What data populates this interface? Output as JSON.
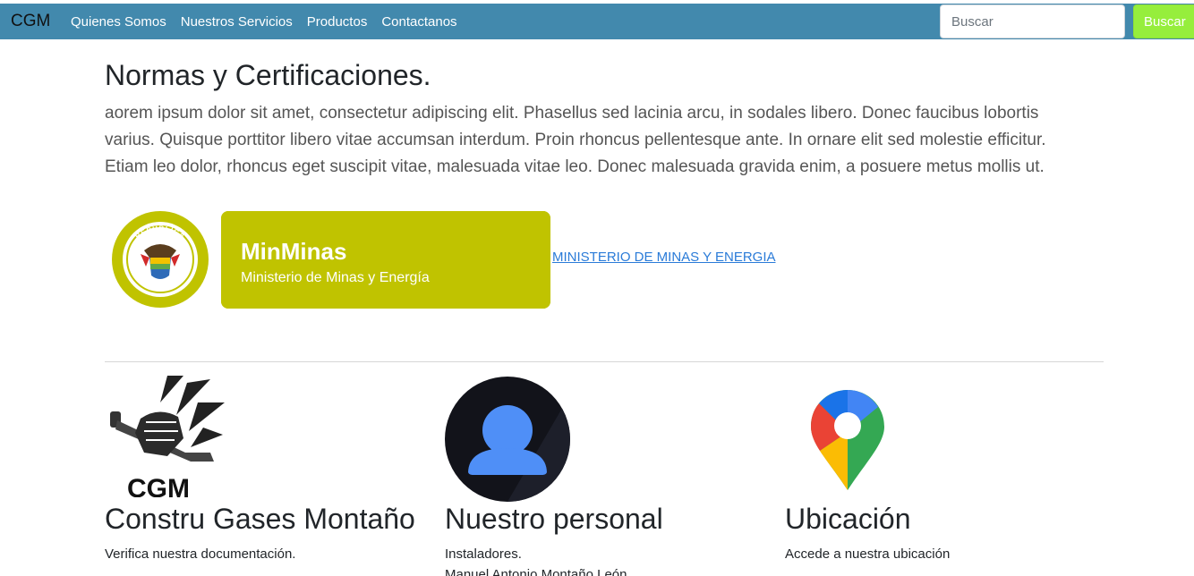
{
  "navbar": {
    "brand": "CGM",
    "links": [
      "Quienes Somos",
      "Nuestros Servicios",
      "Productos",
      "Contactanos"
    ],
    "search": {
      "placeholder": "Buscar",
      "value": ""
    },
    "search_button": "Buscar",
    "colors": {
      "bar": "#4289ad",
      "search_button": "#96ee3c"
    }
  },
  "section": {
    "title": "Normas y Certificaciones.",
    "paragraph": "aorem ipsum dolor sit amet, consectetur adipiscing elit. Phasellus sed lacinia arcu, in sodales libero. Donec faucibus lobortis varius. Quisque porttitor libero vitae accumsan interdum. Proin rhoncus pellentesque ante. In ornare elit sed molestie efficitur. Etiam leo dolor, rhoncus eget suscipit vitae, malesuada vitae leo. Donec malesuada gravida enim, a posuere metus mollis ut.",
    "logo": {
      "seal_top": "REPÚBLICA",
      "seal_bottom": "DE COLOMBIA",
      "name": "MinMinas",
      "subtitle": "Ministerio de Minas y Energía",
      "color": "#c0c300"
    },
    "link": "MINISTERIO DE MINAS Y ENERGIA"
  },
  "columns": [
    {
      "title": "Constru Gases Montaño",
      "text": "Verifica nuestra documentación.",
      "icon": "fist-wrench-logo-icon",
      "logo_text": "CGM"
    },
    {
      "title": "Nuestro personal",
      "text": "Instaladores.",
      "text2": "Manuel Antonio Montaño León",
      "icon": "user-avatar-icon"
    },
    {
      "title": "Ubicación",
      "text": "Accede a nuestra ubicación",
      "icon": "map-pin-icon"
    }
  ]
}
